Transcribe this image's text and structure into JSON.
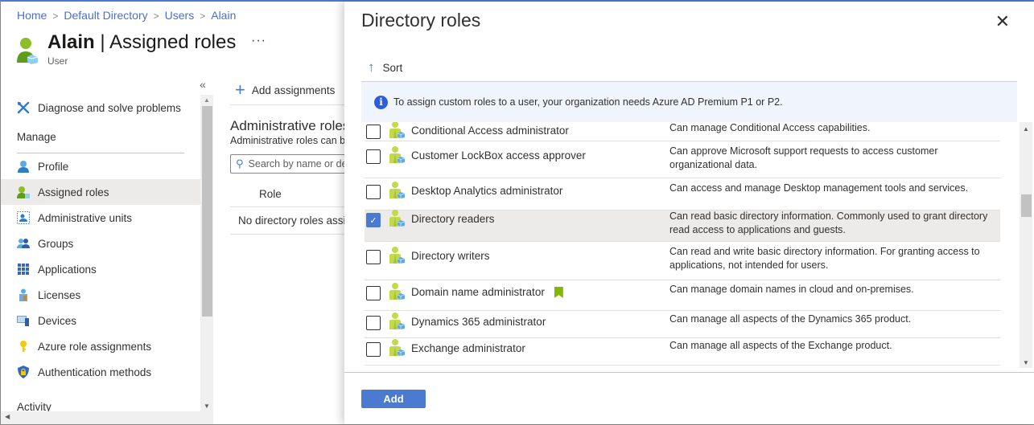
{
  "breadcrumb": [
    {
      "label": "Home"
    },
    {
      "label": "Default Directory"
    },
    {
      "label": "Users"
    },
    {
      "label": "Alain"
    }
  ],
  "header": {
    "user_name": "Alain",
    "separator": " | ",
    "page_name": "Assigned roles",
    "subtitle": "User",
    "more_label": "···"
  },
  "sidebar": {
    "collapse_label": "«",
    "items": [
      {
        "type": "item",
        "label": "Diagnose and solve problems",
        "icon": "wrench-icon"
      },
      {
        "type": "section",
        "label": "Manage"
      },
      {
        "type": "item",
        "label": "Profile",
        "icon": "profile-icon"
      },
      {
        "type": "item",
        "label": "Assigned roles",
        "icon": "assigned-roles-icon",
        "selected": true
      },
      {
        "type": "item",
        "label": "Administrative units",
        "icon": "admin-units-icon"
      },
      {
        "type": "item",
        "label": "Groups",
        "icon": "groups-icon"
      },
      {
        "type": "item",
        "label": "Applications",
        "icon": "applications-icon"
      },
      {
        "type": "item",
        "label": "Licenses",
        "icon": "licenses-icon"
      },
      {
        "type": "item",
        "label": "Devices",
        "icon": "devices-icon"
      },
      {
        "type": "item",
        "label": "Azure role assignments",
        "icon": "key-icon"
      },
      {
        "type": "item",
        "label": "Authentication methods",
        "icon": "shield-icon"
      },
      {
        "type": "section",
        "label": "Activity"
      }
    ]
  },
  "main": {
    "add_assignments_label": "Add assignments",
    "admin_roles_title": "Administrative roles",
    "admin_roles_desc": "Administrative roles can be",
    "search_placeholder": "Search by name or description",
    "role_column": "Role",
    "empty_message": "No directory roles assigned"
  },
  "panel": {
    "title": "Directory roles",
    "sort_label": "Sort",
    "info_text": "To assign custom roles to a user, your organization needs Azure AD Premium P1 or P2.",
    "add_button": "Add",
    "roles": [
      {
        "name": "Conditional Access administrator",
        "description": "Can manage Conditional Access capabilities.",
        "checked": false
      },
      {
        "name": "Customer LockBox access approver",
        "description": "Can approve Microsoft support requests to access customer organizational data.",
        "checked": false
      },
      {
        "name": "Desktop Analytics administrator",
        "description": "Can access and manage Desktop management tools and services.",
        "checked": false
      },
      {
        "name": "Directory readers",
        "description": "Can read basic directory information. Commonly used to grant directory read access to applications and guests.",
        "checked": true
      },
      {
        "name": "Directory writers",
        "description": "Can read and write basic directory information. For granting access to applications, not intended for users.",
        "checked": false
      },
      {
        "name": "Domain name administrator",
        "description": "Can manage domain names in cloud and on-premises.",
        "checked": false,
        "bookmark": true
      },
      {
        "name": "Dynamics 365 administrator",
        "description": "Can manage all aspects of the Dynamics 365 product.",
        "checked": false
      },
      {
        "name": "Exchange administrator",
        "description": "Can manage all aspects of the Exchange product.",
        "checked": false
      }
    ]
  }
}
